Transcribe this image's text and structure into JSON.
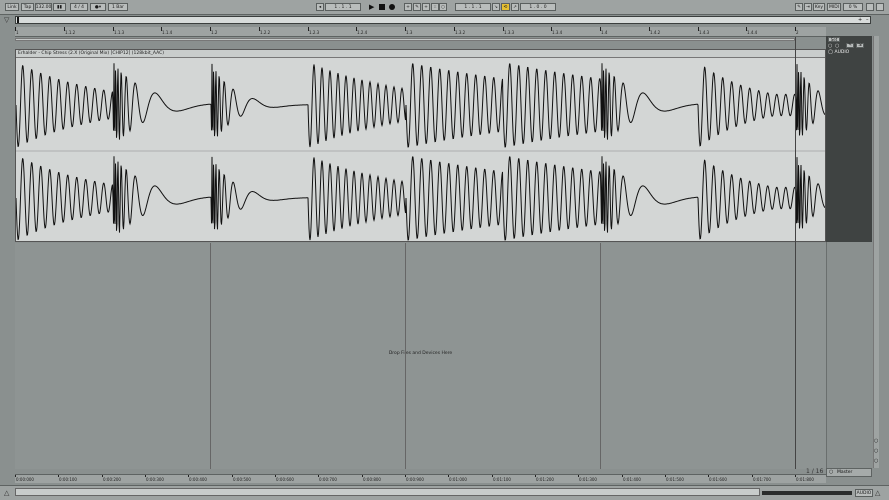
{
  "transport": {
    "link": "Link",
    "tap": "Tap",
    "tempo": "132.00",
    "meter": "4 / 4",
    "quantize": "1 Bar",
    "position": "1 . 1 . 1",
    "loop_start": "1 . 1 . 1",
    "loop_length": "1 . 0 . 0",
    "key": "Key",
    "midi": "MIDI",
    "cpu": "0 %"
  },
  "ruler": {
    "labels": [
      "1",
      "1.1.2",
      "1.1.3",
      "1.1.4",
      "1.2",
      "1.2.2",
      "1.2.3",
      "1.2.4",
      "1.3",
      "1.3.2",
      "1.3.3",
      "1.3.4",
      "1.4",
      "1.4.2",
      "1.4.3",
      "1.4.4",
      "2"
    ]
  },
  "clip": {
    "title": "Erhalder - Chip Stress (2.X (Original Mix) [CHIP12] (128kbit_AAC)"
  },
  "right_panel": {
    "set_label": "Set",
    "track_label": "AUDIO",
    "master_label": "Master",
    "zoom": "1 / 16"
  },
  "drop_hint": "Drop Files and Devices Here",
  "timeline": {
    "labels": [
      "0:00:000",
      "0:00:100",
      "0:00:200",
      "0:00:300",
      "0:00:400",
      "0:00:500",
      "0:00:600",
      "0:00:700",
      "0:00:800",
      "0:00:900",
      "0:01:000",
      "0:01:100",
      "0:01:200",
      "0:01:300",
      "0:01:400",
      "0:01:500",
      "0:01:600",
      "0:01:700",
      "0:01:800"
    ]
  },
  "status": {
    "track_type": "AUDIO"
  },
  "colors": {
    "accent": "#e6c032",
    "waveform": "#111111",
    "clip_bg": "#d3d6d5"
  }
}
